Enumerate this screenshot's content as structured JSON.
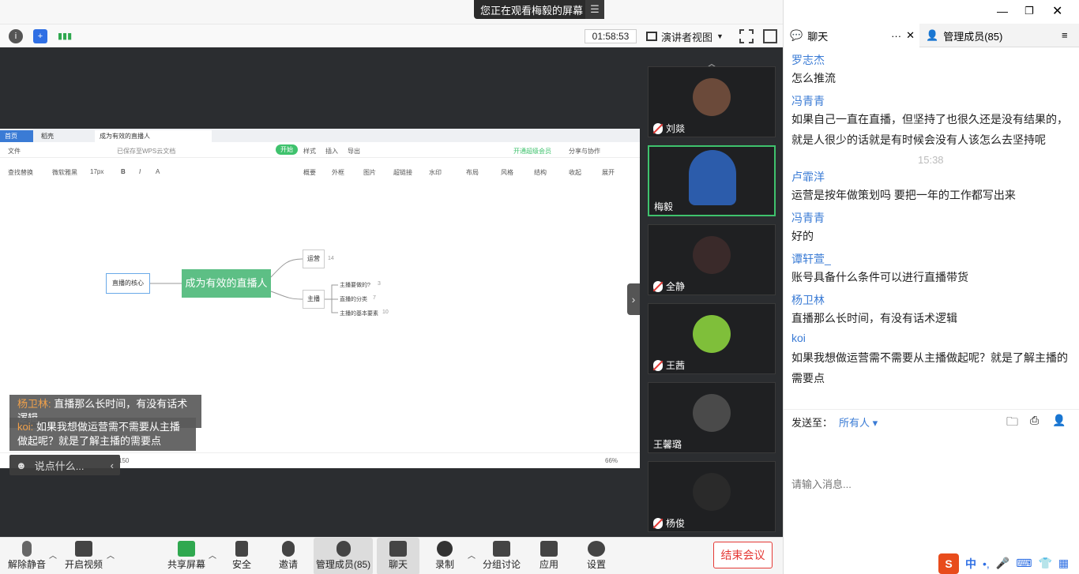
{
  "banner": {
    "text": "您正在观看梅毅的屏幕",
    "menu_icon": "menu-icon"
  },
  "toolbar": {
    "timer": "01:58:53",
    "presenter_view": "演讲者视图"
  },
  "doc": {
    "tabs": [
      "首页",
      "稻壳",
      "成为有效的直播人"
    ],
    "menu": [
      "文件",
      "已保存至WPS云文档",
      "开始",
      "样式",
      "插入",
      "导出",
      "开通超级会员",
      "分享与协作"
    ],
    "tools": [
      "查找替换",
      "微软雅黑",
      "17px",
      "B",
      "I",
      "A",
      "概要",
      "外框",
      "图片",
      "超链接",
      "水印",
      "布局",
      "风格",
      "结构",
      "收起",
      "展开"
    ],
    "root": "成为有效的直播人",
    "left": "直播的核心",
    "branch1": "运营",
    "branch2": "主播",
    "leaves": [
      "主播要做的?",
      "直播的分类",
      "主播的基本要素"
    ],
    "leaf_counts": [
      "3",
      "7",
      "10"
    ],
    "branch1_count": "14",
    "zoom": "66%",
    "status_count": "150"
  },
  "overlays": [
    {
      "name": "杨卫林:",
      "text": "直播那么长时间，有没有话术逻辑"
    },
    {
      "name": "koi:",
      "text": "如果我想做运营需不需要从主播做起呢？就是了解主播的需要点"
    }
  ],
  "say_placeholder": "说点什么...",
  "participants": [
    {
      "name": "刘燚",
      "muted": true,
      "avatar_color": "#6b4a3a"
    },
    {
      "name": "梅毅",
      "muted": false,
      "avatar_color": "#2c5cab",
      "active": true
    },
    {
      "name": "全静",
      "muted": true,
      "avatar_color": "#3a2a2a"
    },
    {
      "name": "王茜",
      "muted": true,
      "avatar_color": "#7fbf3a"
    },
    {
      "name": "王馨璐",
      "muted": false,
      "avatar_color": "#4a4a4a"
    },
    {
      "name": "杨俊",
      "muted": true,
      "avatar_color": "#2a2a2a"
    }
  ],
  "right": {
    "chat_tab": "聊天",
    "members_tab": "管理成员(85)",
    "messages": [
      {
        "name": "罗志杰",
        "text": "怎么推流"
      },
      {
        "name": "冯青青",
        "text": "如果自己一直在直播，但坚持了也很久还是没有结果的，就是人很少的话就是有时候会没有人该怎么去坚持呢"
      },
      {
        "name": "卢霏洋",
        "text": "运营是按年做策划吗 要把一年的工作都写出来"
      },
      {
        "name": "冯青青",
        "text": "好的"
      },
      {
        "name": "谭轩萱_",
        "text": "账号具备什么条件可以进行直播带货"
      },
      {
        "name": "杨卫林",
        "text": "直播那么长时间，有没有话术逻辑"
      },
      {
        "name": "koi",
        "text": "如果我想做运营需不需要从主播做起呢？就是了解主播的需要点"
      }
    ],
    "timestamp": "15:38",
    "send_to_label": "发送至：",
    "send_to_target": "所有人",
    "input_placeholder": "请输入消息..."
  },
  "bottom": {
    "unmute": "解除静音",
    "video": "开启视频",
    "share": "共享屏幕",
    "security": "安全",
    "invite": "邀请",
    "members": "管理成员(85)",
    "chat": "聊天",
    "record": "录制",
    "breakout": "分组讨论",
    "apps": "应用",
    "settings": "设置",
    "end": "结束会议"
  },
  "ime": {
    "label": "中"
  },
  "colors": {
    "accent_blue": "#3a7bd5",
    "end_red": "#e53935",
    "active_green": "#3fc26d",
    "mindmap_green": "#5dbf85"
  }
}
